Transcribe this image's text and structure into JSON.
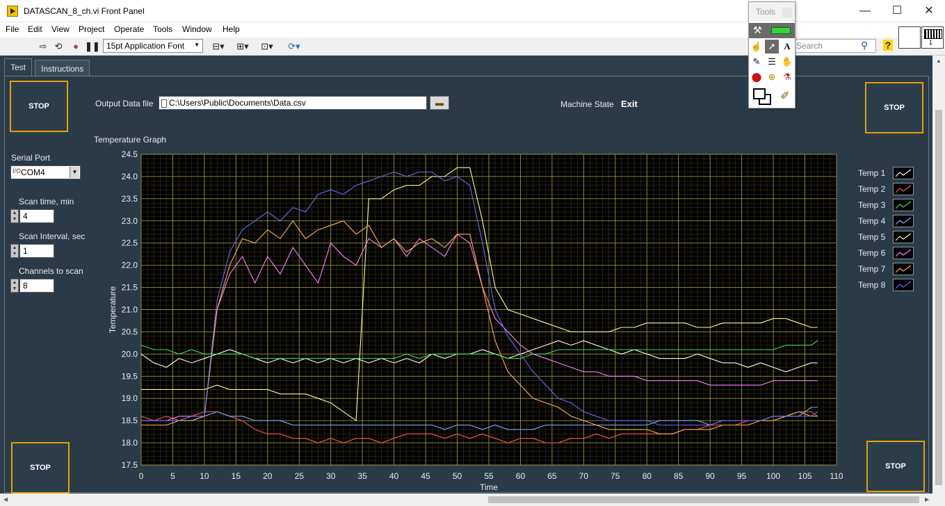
{
  "window": {
    "title": "DATASCAN_8_ch.vi Front Panel",
    "controls": {
      "minimize": "—",
      "maximize": "☐",
      "close": "✕"
    }
  },
  "menu": [
    "File",
    "Edit",
    "View",
    "Project",
    "Operate",
    "Tools",
    "Window",
    "Help"
  ],
  "toolbar": {
    "font": "15pt Application Font",
    "search_placeholder": "Search"
  },
  "connector": {
    "label": "1"
  },
  "tabs": [
    {
      "label": "Test",
      "active": true
    },
    {
      "label": "Instructions",
      "active": false
    }
  ],
  "stop_buttons": {
    "top_left": "STOP",
    "top_right": "STOP",
    "bottom_left": "STOP",
    "bottom_right": "STOP"
  },
  "output_file": {
    "label": "Output Data file",
    "value": "C:\\Users\\Public\\Documents\\Data.csv"
  },
  "machine_state": {
    "label": "Machine State",
    "value": "Exit"
  },
  "serial_port": {
    "label": "Serial Port",
    "value": "COM4"
  },
  "scan_time": {
    "label": "Scan time, min",
    "value": "4"
  },
  "scan_interval": {
    "label": "Scan Interval, sec",
    "value": "1"
  },
  "channels": {
    "label": "Channels to scan",
    "value": "8"
  },
  "graph_label": "Temperature Graph",
  "tools_palette": {
    "title": "Tools"
  },
  "colors": {
    "panel_bg": "#2c3e4c",
    "plot_bg": "#000000",
    "grid": "#a8a83c",
    "stop_border": "#e6a100"
  },
  "chart_data": {
    "type": "line",
    "title": "Temperature Graph",
    "xlabel": "Time",
    "ylabel": "Temperature",
    "xlim": [
      0,
      110
    ],
    "ylim": [
      17.5,
      24.5
    ],
    "x_ticks": [
      0,
      5,
      10,
      15,
      20,
      25,
      30,
      35,
      40,
      45,
      50,
      55,
      60,
      65,
      70,
      75,
      80,
      85,
      90,
      95,
      100,
      105,
      110
    ],
    "y_ticks": [
      17.5,
      18.0,
      18.5,
      19.0,
      19.5,
      20.0,
      20.5,
      21.0,
      21.5,
      22.0,
      22.5,
      23.0,
      23.5,
      24.0,
      24.5
    ],
    "grid": true,
    "legend": "right",
    "x": [
      0,
      2,
      4,
      6,
      8,
      10,
      12,
      14,
      16,
      18,
      20,
      22,
      24,
      26,
      28,
      30,
      32,
      34,
      36,
      38,
      40,
      42,
      44,
      46,
      48,
      50,
      52,
      54,
      56,
      58,
      60,
      62,
      64,
      66,
      68,
      70,
      72,
      74,
      76,
      78,
      80,
      82,
      84,
      86,
      88,
      90,
      92,
      94,
      96,
      98,
      100,
      102,
      104,
      106,
      107
    ],
    "series": [
      {
        "name": "Temp 1",
        "color": "#ffffff",
        "values": [
          20.0,
          19.8,
          19.7,
          19.9,
          19.8,
          19.9,
          20.0,
          20.1,
          20.0,
          19.9,
          19.8,
          19.9,
          19.8,
          19.9,
          19.8,
          19.9,
          19.8,
          19.9,
          19.8,
          19.9,
          19.8,
          19.9,
          19.8,
          20.0,
          19.9,
          20.0,
          20.0,
          20.1,
          20.0,
          19.9,
          20.0,
          20.1,
          20.2,
          20.3,
          20.2,
          20.3,
          20.2,
          20.1,
          20.0,
          20.1,
          20.0,
          19.9,
          19.9,
          19.9,
          20.0,
          19.9,
          19.8,
          19.8,
          19.7,
          19.8,
          19.7,
          19.6,
          19.7,
          19.8,
          19.8
        ]
      },
      {
        "name": "Temp 2",
        "color": "#ff5a4a",
        "values": [
          18.6,
          18.5,
          18.6,
          18.5,
          18.6,
          18.7,
          18.7,
          18.6,
          18.5,
          18.3,
          18.2,
          18.2,
          18.1,
          18.1,
          18.0,
          18.1,
          18.0,
          18.1,
          18.1,
          18.0,
          18.1,
          18.2,
          18.2,
          18.2,
          18.1,
          18.2,
          18.1,
          18.2,
          18.1,
          18.0,
          18.1,
          18.1,
          18.0,
          18.0,
          18.1,
          18.1,
          18.2,
          18.1,
          18.2,
          18.2,
          18.2,
          18.2,
          18.2,
          18.3,
          18.3,
          18.4,
          18.4,
          18.4,
          18.5,
          18.5,
          18.5,
          18.6,
          18.7,
          18.7,
          18.6
        ]
      },
      {
        "name": "Temp 3",
        "color": "#4adc4a",
        "values": [
          20.2,
          20.1,
          20.1,
          20.0,
          20.1,
          20.0,
          20.0,
          20.0,
          20.0,
          19.9,
          19.9,
          19.9,
          19.9,
          19.9,
          19.9,
          19.9,
          19.9,
          19.9,
          19.9,
          19.9,
          19.9,
          20.0,
          19.9,
          20.0,
          20.0,
          20.0,
          20.0,
          20.0,
          20.0,
          19.9,
          19.9,
          20.0,
          20.0,
          20.1,
          20.1,
          20.1,
          20.1,
          20.1,
          20.1,
          20.1,
          20.1,
          20.1,
          20.1,
          20.1,
          20.1,
          20.1,
          20.1,
          20.1,
          20.1,
          20.1,
          20.1,
          20.2,
          20.2,
          20.2,
          20.3
        ]
      },
      {
        "name": "Temp 4",
        "color": "#7fb0ff",
        "values": [
          18.5,
          18.5,
          18.5,
          18.5,
          18.5,
          18.6,
          18.7,
          18.6,
          18.6,
          18.5,
          18.5,
          18.5,
          18.4,
          18.4,
          18.4,
          18.4,
          18.4,
          18.4,
          18.4,
          18.4,
          18.4,
          18.4,
          18.4,
          18.4,
          18.3,
          18.4,
          18.4,
          18.3,
          18.4,
          18.3,
          18.3,
          18.3,
          18.4,
          18.4,
          18.4,
          18.4,
          18.4,
          18.4,
          18.4,
          18.4,
          18.4,
          18.5,
          18.5,
          18.5,
          18.5,
          18.4,
          18.5,
          18.5,
          18.5,
          18.5,
          18.6,
          18.6,
          18.6,
          18.8,
          18.8
        ]
      },
      {
        "name": "Temp 5",
        "color": "#ffff99",
        "values": [
          19.2,
          19.2,
          19.2,
          19.2,
          19.2,
          19.2,
          19.3,
          19.2,
          19.2,
          19.2,
          19.2,
          19.1,
          19.1,
          19.1,
          19.0,
          18.9,
          18.7,
          18.5,
          23.5,
          23.5,
          23.7,
          23.8,
          23.8,
          24.0,
          24.0,
          24.2,
          24.2,
          23.0,
          21.5,
          21.0,
          20.9,
          20.8,
          20.7,
          20.6,
          20.5,
          20.5,
          20.5,
          20.5,
          20.6,
          20.6,
          20.7,
          20.7,
          20.7,
          20.7,
          20.6,
          20.6,
          20.7,
          20.7,
          20.7,
          20.7,
          20.8,
          20.8,
          20.7,
          20.6,
          20.6
        ]
      },
      {
        "name": "Temp 6",
        "color": "#ff80ff",
        "values": [
          18.5,
          18.5,
          18.5,
          18.6,
          18.6,
          18.6,
          21.0,
          21.8,
          22.2,
          21.6,
          22.2,
          21.8,
          22.4,
          22.0,
          21.6,
          22.5,
          22.2,
          22.0,
          22.6,
          22.4,
          22.6,
          22.2,
          22.6,
          22.4,
          22.2,
          22.7,
          22.5,
          21.5,
          20.8,
          20.5,
          20.2,
          20.0,
          19.9,
          19.8,
          19.7,
          19.6,
          19.6,
          19.5,
          19.5,
          19.5,
          19.4,
          19.4,
          19.4,
          19.4,
          19.4,
          19.3,
          19.3,
          19.3,
          19.3,
          19.3,
          19.4,
          19.4,
          19.4,
          19.4,
          19.4
        ]
      },
      {
        "name": "Temp 7",
        "color": "#ffb34a",
        "values": [
          18.4,
          18.4,
          18.4,
          18.5,
          18.5,
          18.6,
          21.0,
          22.0,
          22.6,
          22.5,
          22.8,
          22.6,
          23.0,
          22.6,
          22.8,
          22.9,
          23.0,
          22.7,
          22.9,
          22.4,
          22.6,
          22.3,
          22.5,
          22.6,
          22.4,
          22.7,
          22.7,
          21.5,
          20.3,
          19.6,
          19.3,
          19.0,
          18.9,
          18.8,
          18.6,
          18.5,
          18.4,
          18.3,
          18.3,
          18.3,
          18.3,
          18.2,
          18.2,
          18.3,
          18.3,
          18.3,
          18.4,
          18.4,
          18.4,
          18.5,
          18.5,
          18.6,
          18.7,
          18.6,
          18.6
        ]
      },
      {
        "name": "Temp 8",
        "color": "#6a6aff",
        "values": [
          18.5,
          18.5,
          18.5,
          18.5,
          18.6,
          18.6,
          21.2,
          22.3,
          22.8,
          23.0,
          23.2,
          23.0,
          23.3,
          23.2,
          23.6,
          23.7,
          23.6,
          23.8,
          23.9,
          24.0,
          24.1,
          24.0,
          24.1,
          24.1,
          23.9,
          24.0,
          23.8,
          22.5,
          21.0,
          20.4,
          20.0,
          19.6,
          19.3,
          19.0,
          18.9,
          18.7,
          18.6,
          18.5,
          18.5,
          18.5,
          18.5,
          18.4,
          18.4,
          18.4,
          18.4,
          18.4,
          18.5,
          18.5,
          18.5,
          18.5,
          18.6,
          18.6,
          18.6,
          18.6,
          18.7
        ]
      }
    ]
  }
}
